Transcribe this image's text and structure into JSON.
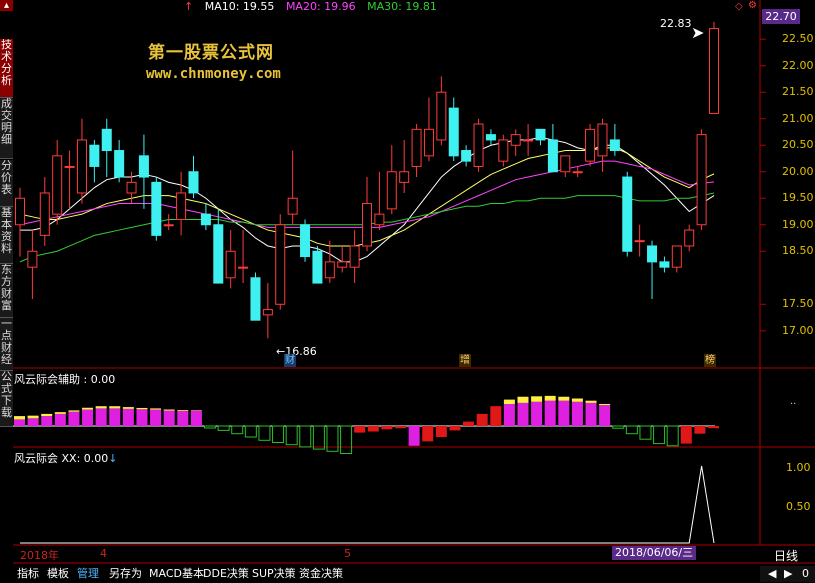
{
  "legend": {
    "ma10_label": "MA10: 19.55",
    "ma20_label": "MA20: 19.96",
    "ma30_label": "MA30: 19.81"
  },
  "watermark": {
    "line1": "第一股票公式网",
    "line2": "www.chnmoney.com"
  },
  "sidebar": {
    "items": [
      {
        "label": "技术分析",
        "active": true
      },
      {
        "label": "成交明细",
        "active": false
      },
      {
        "label": "分价表",
        "active": false
      },
      {
        "label": "基本资料",
        "active": false
      },
      {
        "label": "东方财富",
        "active": false
      },
      {
        "label": "一点财经",
        "active": false
      },
      {
        "label": "公式下载",
        "active": false
      }
    ]
  },
  "price_axis": {
    "current_price": "22.70",
    "ticks": [
      "22.50",
      "22.00",
      "21.50",
      "21.00",
      "20.50",
      "20.00",
      "19.50",
      "19.00",
      "18.50",
      "17.50",
      "17.00"
    ]
  },
  "annotations": {
    "high_price": "22.83",
    "low_price": "16.86",
    "marker_cai": "财",
    "marker_zeng": "增",
    "marker_bang": "榜"
  },
  "indicator1": {
    "title": "风云际会辅助 : 0.00",
    "axis_tick": "0.00"
  },
  "indicator2": {
    "title": "风云际会 XX: 0.00",
    "axis_ticks": [
      "1.00",
      "0.50"
    ]
  },
  "time_axis": {
    "year_label": "2018年",
    "month4": "4",
    "month5": "5",
    "cursor_date": "2018/06/06/三"
  },
  "period_label": "日线",
  "bottom_toolbar": {
    "items": [
      {
        "label": "指标",
        "active": false
      },
      {
        "label": "模板",
        "active": false
      },
      {
        "label": "管理",
        "active": true
      },
      {
        "label": "另存为",
        "active": false
      },
      {
        "label": "MACD基本",
        "active": false
      },
      {
        "label": "DDE决策",
        "active": false
      },
      {
        "label": "SUP决策",
        "active": false
      },
      {
        "label": "资金决策",
        "active": false
      }
    ],
    "scroll_value": "0"
  },
  "colors": {
    "up": "#ff3b3b",
    "down": "#3ff0f0",
    "ma10": "#ffffff",
    "ma20": "#ffff66",
    "ma30": "#ff44ff",
    "ma60": "#33cc33",
    "bar_magenta": "#e020e0",
    "bar_yellow": "#ffee44",
    "bar_red": "#e01818",
    "bar_green": "#2bbf2b",
    "axis_red": "#b00000",
    "label_purple": "#5a2a8a"
  },
  "chart_data": {
    "type": "candlestick",
    "interval": "daily",
    "candles": [
      {
        "o": 19.0,
        "h": 19.7,
        "l": 18.4,
        "c": 19.5
      },
      {
        "o": 18.2,
        "h": 18.9,
        "l": 17.6,
        "c": 18.5
      },
      {
        "o": 18.8,
        "h": 19.9,
        "l": 18.6,
        "c": 19.6
      },
      {
        "o": 19.2,
        "h": 20.6,
        "l": 19.0,
        "c": 20.3
      },
      {
        "o": 20.1,
        "h": 20.4,
        "l": 19.3,
        "c": 20.1
      },
      {
        "o": 19.6,
        "h": 21.0,
        "l": 19.4,
        "c": 20.6
      },
      {
        "o": 20.5,
        "h": 20.6,
        "l": 19.8,
        "c": 20.1
      },
      {
        "o": 20.8,
        "h": 21.0,
        "l": 19.9,
        "c": 20.4
      },
      {
        "o": 20.4,
        "h": 20.6,
        "l": 19.8,
        "c": 19.9
      },
      {
        "o": 19.6,
        "h": 20.0,
        "l": 19.4,
        "c": 19.8
      },
      {
        "o": 20.3,
        "h": 20.7,
        "l": 19.3,
        "c": 19.9
      },
      {
        "o": 19.8,
        "h": 19.9,
        "l": 18.7,
        "c": 18.8
      },
      {
        "o": 19.0,
        "h": 19.2,
        "l": 18.9,
        "c": 19.0
      },
      {
        "o": 19.1,
        "h": 20.0,
        "l": 18.8,
        "c": 19.6
      },
      {
        "o": 20.0,
        "h": 20.3,
        "l": 19.5,
        "c": 19.6
      },
      {
        "o": 19.2,
        "h": 19.4,
        "l": 18.9,
        "c": 19.0
      },
      {
        "o": 19.0,
        "h": 19.3,
        "l": 17.9,
        "c": 17.9
      },
      {
        "o": 18.0,
        "h": 18.9,
        "l": 17.8,
        "c": 18.5
      },
      {
        "o": 18.2,
        "h": 18.9,
        "l": 17.9,
        "c": 18.2
      },
      {
        "o": 18.0,
        "h": 18.1,
        "l": 17.2,
        "c": 17.2
      },
      {
        "o": 17.3,
        "h": 17.9,
        "l": 16.86,
        "c": 17.4
      },
      {
        "o": 17.5,
        "h": 19.2,
        "l": 17.4,
        "c": 19.0
      },
      {
        "o": 19.2,
        "h": 20.4,
        "l": 19.0,
        "c": 19.5
      },
      {
        "o": 19.0,
        "h": 19.1,
        "l": 18.3,
        "c": 18.4
      },
      {
        "o": 18.5,
        "h": 18.6,
        "l": 17.9,
        "c": 17.9
      },
      {
        "o": 18.0,
        "h": 18.7,
        "l": 17.9,
        "c": 18.3
      },
      {
        "o": 18.2,
        "h": 18.6,
        "l": 18.1,
        "c": 18.3
      },
      {
        "o": 18.2,
        "h": 18.9,
        "l": 17.9,
        "c": 18.6
      },
      {
        "o": 18.6,
        "h": 19.9,
        "l": 18.5,
        "c": 19.4
      },
      {
        "o": 19.0,
        "h": 20.0,
        "l": 18.9,
        "c": 19.2
      },
      {
        "o": 19.3,
        "h": 20.5,
        "l": 19.2,
        "c": 20.0
      },
      {
        "o": 19.8,
        "h": 20.6,
        "l": 19.6,
        "c": 20.0
      },
      {
        "o": 20.1,
        "h": 20.9,
        "l": 19.9,
        "c": 20.8
      },
      {
        "o": 20.3,
        "h": 21.4,
        "l": 20.2,
        "c": 20.8
      },
      {
        "o": 20.6,
        "h": 21.8,
        "l": 20.5,
        "c": 21.5
      },
      {
        "o": 21.2,
        "h": 21.4,
        "l": 20.2,
        "c": 20.3
      },
      {
        "o": 20.4,
        "h": 20.5,
        "l": 20.1,
        "c": 20.2
      },
      {
        "o": 20.1,
        "h": 21.0,
        "l": 20.0,
        "c": 20.9
      },
      {
        "o": 20.7,
        "h": 20.8,
        "l": 20.5,
        "c": 20.6
      },
      {
        "o": 20.2,
        "h": 20.7,
        "l": 20.1,
        "c": 20.6
      },
      {
        "o": 20.5,
        "h": 20.8,
        "l": 20.3,
        "c": 20.7
      },
      {
        "o": 20.6,
        "h": 20.9,
        "l": 20.3,
        "c": 20.6
      },
      {
        "o": 20.8,
        "h": 20.8,
        "l": 20.5,
        "c": 20.6
      },
      {
        "o": 20.6,
        "h": 20.9,
        "l": 20.0,
        "c": 20.0
      },
      {
        "o": 20.0,
        "h": 20.3,
        "l": 19.9,
        "c": 20.3
      },
      {
        "o": 20.0,
        "h": 20.1,
        "l": 19.9,
        "c": 20.0
      },
      {
        "o": 20.2,
        "h": 20.9,
        "l": 20.1,
        "c": 20.8
      },
      {
        "o": 20.3,
        "h": 21.0,
        "l": 20.0,
        "c": 20.9
      },
      {
        "o": 20.6,
        "h": 20.9,
        "l": 20.3,
        "c": 20.4
      },
      {
        "o": 19.9,
        "h": 20.0,
        "l": 18.4,
        "c": 18.5
      },
      {
        "o": 18.7,
        "h": 19.0,
        "l": 18.4,
        "c": 18.7
      },
      {
        "o": 18.6,
        "h": 18.7,
        "l": 17.6,
        "c": 18.3
      },
      {
        "o": 18.3,
        "h": 18.4,
        "l": 18.1,
        "c": 18.2
      },
      {
        "o": 18.2,
        "h": 18.6,
        "l": 18.1,
        "c": 18.6
      },
      {
        "o": 18.6,
        "h": 19.0,
        "l": 18.5,
        "c": 18.9
      },
      {
        "o": 19.0,
        "h": 20.8,
        "l": 18.9,
        "c": 20.7
      },
      {
        "o": 21.1,
        "h": 22.83,
        "l": 21.6,
        "c": 22.7
      }
    ],
    "ma": [
      {
        "name": "MA10",
        "values": [
          18.9,
          18.9,
          18.95,
          19.1,
          19.3,
          19.5,
          19.7,
          19.85,
          19.9,
          19.9,
          19.95,
          19.9,
          19.8,
          19.75,
          19.65,
          19.5,
          19.3,
          19.1,
          18.95,
          18.75,
          18.6,
          18.55,
          18.6,
          18.6,
          18.55,
          18.45,
          18.3,
          18.3,
          18.4,
          18.6,
          18.8,
          19.0,
          19.3,
          19.6,
          19.9,
          20.1,
          20.25,
          20.4,
          20.5,
          20.55,
          20.6,
          20.6,
          20.65,
          20.6,
          20.55,
          20.45,
          20.4,
          20.5,
          20.5,
          20.35,
          20.15,
          19.95,
          19.75,
          19.5,
          19.25,
          19.4,
          19.55
        ]
      },
      {
        "name": "MA20",
        "values": [
          19.2,
          19.15,
          19.1,
          19.1,
          19.15,
          19.2,
          19.3,
          19.4,
          19.45,
          19.5,
          19.55,
          19.55,
          19.55,
          19.5,
          19.45,
          19.4,
          19.3,
          19.2,
          19.1,
          19.0,
          18.9,
          18.85,
          18.8,
          18.75,
          18.65,
          18.6,
          18.6,
          18.6,
          18.65,
          18.7,
          18.8,
          18.9,
          19.05,
          19.2,
          19.35,
          19.5,
          19.65,
          19.8,
          19.95,
          20.05,
          20.15,
          20.25,
          20.3,
          20.35,
          20.4,
          20.4,
          20.4,
          20.45,
          20.45,
          20.35,
          20.2,
          20.05,
          19.9,
          19.8,
          19.7,
          19.85,
          19.96
        ]
      },
      {
        "name": "MA30",
        "values": [
          19.0,
          19.05,
          19.1,
          19.15,
          19.2,
          19.25,
          19.3,
          19.35,
          19.4,
          19.4,
          19.4,
          19.4,
          19.35,
          19.3,
          19.25,
          19.2,
          19.15,
          19.1,
          19.05,
          19.0,
          18.95,
          18.95,
          18.95,
          18.95,
          18.95,
          18.95,
          18.95,
          18.95,
          18.95,
          18.95,
          19.0,
          19.05,
          19.1,
          19.15,
          19.25,
          19.35,
          19.45,
          19.55,
          19.65,
          19.75,
          19.85,
          19.9,
          19.95,
          20.0,
          20.05,
          20.1,
          20.15,
          20.2,
          20.2,
          20.15,
          20.1,
          20.05,
          19.95,
          19.85,
          19.75,
          19.78,
          19.81
        ]
      },
      {
        "name": "MA60",
        "values": [
          18.3,
          18.4,
          18.45,
          18.5,
          18.6,
          18.7,
          18.8,
          18.85,
          18.9,
          18.95,
          19.0,
          19.05,
          19.1,
          19.1,
          19.1,
          19.1,
          19.1,
          19.05,
          19.05,
          19.0,
          19.0,
          19.0,
          19.0,
          19.0,
          19.0,
          19.0,
          19.0,
          19.0,
          19.0,
          19.05,
          19.05,
          19.1,
          19.15,
          19.2,
          19.25,
          19.3,
          19.35,
          19.35,
          19.4,
          19.4,
          19.45,
          19.45,
          19.5,
          19.5,
          19.5,
          19.55,
          19.55,
          19.55,
          19.55,
          19.5,
          19.45,
          19.45,
          19.45,
          19.5,
          19.5,
          19.55,
          19.6
        ]
      }
    ],
    "price_range": [
      16.6,
      22.9
    ],
    "indicator1_bars": [
      {
        "v": 0.3,
        "k": "mag",
        "y": 0.15
      },
      {
        "v": 0.35,
        "k": "mag",
        "y": 0.12
      },
      {
        "v": 0.45,
        "k": "mag",
        "y": 0.1
      },
      {
        "v": 0.55,
        "k": "mag",
        "y": 0.08
      },
      {
        "v": 0.65,
        "k": "mag",
        "y": 0.06
      },
      {
        "v": 0.75,
        "k": "mag",
        "y": 0.08
      },
      {
        "v": 0.8,
        "k": "mag",
        "y": 0.1
      },
      {
        "v": 0.8,
        "k": "mag",
        "y": 0.1
      },
      {
        "v": 0.78,
        "k": "mag",
        "y": 0.08
      },
      {
        "v": 0.76,
        "k": "mag",
        "y": 0.06
      },
      {
        "v": 0.75,
        "k": "mag",
        "y": 0.05
      },
      {
        "v": 0.7,
        "k": "mag",
        "y": 0.05
      },
      {
        "v": 0.68,
        "k": "mag",
        "y": 0.04
      },
      {
        "v": 0.7,
        "k": "mag",
        "y": 0.02
      },
      {
        "v": -0.05,
        "k": "green"
      },
      {
        "v": -0.2,
        "k": "green"
      },
      {
        "v": -0.35,
        "k": "green"
      },
      {
        "v": -0.5,
        "k": "green"
      },
      {
        "v": -0.65,
        "k": "green"
      },
      {
        "v": -0.75,
        "k": "green"
      },
      {
        "v": -0.85,
        "k": "green"
      },
      {
        "v": -0.95,
        "k": "green"
      },
      {
        "v": -1.05,
        "k": "green"
      },
      {
        "v": -1.15,
        "k": "green"
      },
      {
        "v": -1.25,
        "k": "green"
      },
      {
        "v": -0.3,
        "k": "red"
      },
      {
        "v": -0.25,
        "k": "red"
      },
      {
        "v": -0.15,
        "k": "red"
      },
      {
        "v": -0.1,
        "k": "red"
      },
      {
        "v": -0.9,
        "k": "mag"
      },
      {
        "v": -0.7,
        "k": "red"
      },
      {
        "v": -0.5,
        "k": "red"
      },
      {
        "v": -0.2,
        "k": "red"
      },
      {
        "v": 0.2,
        "k": "red"
      },
      {
        "v": 0.55,
        "k": "red"
      },
      {
        "v": 0.9,
        "k": "red"
      },
      {
        "v": 1.0,
        "k": "mag",
        "y": 0.2
      },
      {
        "v": 1.05,
        "k": "mag",
        "y": 0.28
      },
      {
        "v": 1.1,
        "k": "mag",
        "y": 0.25
      },
      {
        "v": 1.15,
        "k": "mag",
        "y": 0.22
      },
      {
        "v": 1.15,
        "k": "mag",
        "y": 0.18
      },
      {
        "v": 1.1,
        "k": "mag",
        "y": 0.15
      },
      {
        "v": 1.05,
        "k": "mag",
        "y": 0.1
      },
      {
        "v": 0.95,
        "k": "mag",
        "y": 0.05
      },
      {
        "v": -0.1,
        "k": "green"
      },
      {
        "v": -0.35,
        "k": "green"
      },
      {
        "v": -0.6,
        "k": "green"
      },
      {
        "v": -0.8,
        "k": "green"
      },
      {
        "v": -0.9,
        "k": "green"
      },
      {
        "v": -0.8,
        "k": "red"
      },
      {
        "v": -0.35,
        "k": "red"
      },
      {
        "v": -0.1,
        "k": "red"
      }
    ],
    "indicator2_series": [
      0,
      0,
      0,
      0,
      0,
      0,
      0,
      0,
      0,
      0,
      0,
      0,
      0,
      0,
      0,
      0,
      0,
      0,
      0,
      0,
      0,
      0,
      0,
      0,
      0,
      0,
      0,
      0,
      0,
      0,
      0,
      0,
      0,
      0,
      0,
      0,
      0,
      0,
      0,
      0,
      0,
      0,
      0,
      0,
      0,
      0,
      0,
      0,
      0,
      0,
      0,
      0,
      0,
      0,
      0,
      1,
      0
    ]
  }
}
